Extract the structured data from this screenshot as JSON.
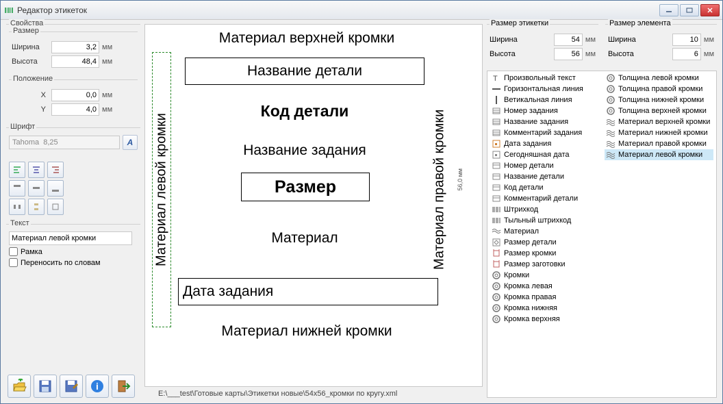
{
  "window": {
    "title": "Редактор этикеток"
  },
  "properties_legend": "Свойства",
  "size": {
    "legend": "Размер",
    "width_label": "Ширина",
    "width_value": "3,2",
    "width_unit": "мм",
    "height_label": "Высота",
    "height_value": "48,4",
    "height_unit": "мм"
  },
  "position": {
    "legend": "Положение",
    "x_label": "X",
    "x_value": "0,0",
    "x_unit": "мм",
    "y_label": "Y",
    "y_value": "4,0",
    "y_unit": "мм"
  },
  "font": {
    "legend": "Шрифт",
    "value": "Tahoma  8,25"
  },
  "text": {
    "legend": "Текст",
    "value": "Материал левой кромки",
    "frame_label": "Рамка",
    "wrap_label": "Переносить по словам"
  },
  "canvas": {
    "top_edge": "Материал верхней кромки",
    "part_name": "Название детали",
    "part_code": "Код детали",
    "job_name": "Название задания",
    "size_label": "Размер",
    "material": "Материал",
    "job_date": "Дата задания",
    "bottom_edge": "Материал нижней кромки",
    "left_edge": "Материал левой кромки",
    "right_edge": "Материал правой кромки",
    "ruler": "56,0 мм"
  },
  "filepath": "E:\\___test\\Готовые карты\\Этикетки новые\\54x56_кромки по кругу.xml",
  "label_size": {
    "legend": "Размер этикетки",
    "width_label": "Ширина",
    "width_value": "54",
    "width_unit": "мм",
    "height_label": "Высота",
    "height_value": "56",
    "height_unit": "мм"
  },
  "element_size": {
    "legend": "Размер элемента",
    "width_label": "Ширина",
    "width_value": "10",
    "width_unit": "мм",
    "height_label": "Высота",
    "height_value": "6",
    "height_unit": "мм"
  },
  "elements_left": [
    "Произвольный текст",
    "Горизонтальная линия",
    "Ветикальная линия",
    "Номер задания",
    "Название задания",
    "Комментарий задания",
    "Дата задания",
    "Сегодняшная дата",
    "Номер детали",
    "Название детали",
    "Код детали",
    "Комментарий детали",
    "Штрихкод",
    "Тыльный штрихкод",
    "Материал",
    "Размер детали",
    "Размер кромки",
    "Размер заготовки",
    "Кромки",
    "Кромка левая",
    "Кромка правая",
    "Кромка нижняя",
    "Кромка верхняя"
  ],
  "elements_right": [
    "Толщина левой кромки",
    "Толщина правой кромки",
    "Толщина нижней кромки",
    "Толщина верхней кромки",
    "Материал верхней кромки",
    "Материал нижней кромки",
    "Материал правой кромки",
    "Материал левой кромки"
  ]
}
